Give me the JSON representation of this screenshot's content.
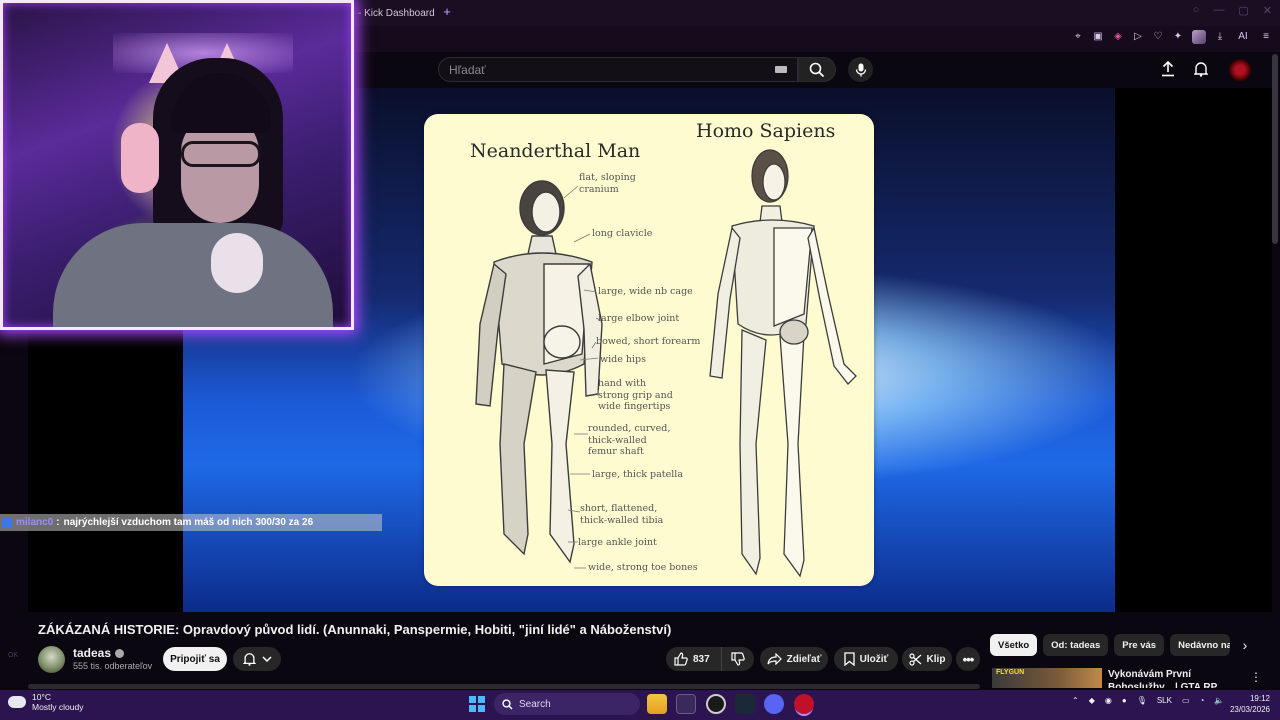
{
  "browser": {
    "tab_title": "- Kick Dashboard",
    "new_tab": "+",
    "ext_ai_label": "AI"
  },
  "youtube": {
    "search_placeholder": "Hľadať"
  },
  "image_card": {
    "title_left": "Neanderthal Man",
    "title_right": "Homo Sapiens",
    "labels": [
      "flat, sloping\ncranium",
      "long clavicle",
      "large, wide nb cage",
      "large elbow joint",
      "bowed, short forearm",
      "wide hips",
      "hand with\nstrong grip and\nwide fingertips",
      "rounded, curved,\nthick-walled\nfemur shaft",
      "large, thick patella",
      "short, flattened,\nthick-walled tibia",
      "large ankle joint",
      "wide, strong toe bones"
    ]
  },
  "chat": {
    "user": "milanc0",
    "separator": ":",
    "message": "najrýchlejší vzduchom tam máš od nich 300/30 za 26"
  },
  "video": {
    "title": "ZÁKÁZANÁ HISTORIE: Opravdový původ lidí. (Anunnaki, Panspermie, Hobiti, \"jiní lidé\" a Náboženství)",
    "channel": "tadeas",
    "subscribers": "555 tis. odberateľov",
    "join_label": "Pripojiť sa",
    "likes": "837",
    "share_label": "Zdieľať",
    "save_label": "Uložiť",
    "clip_label": "Klip"
  },
  "chips": [
    "Všetko",
    "Od: tadeas",
    "Pre vás",
    "Nedávno nahr"
  ],
  "recommendation": {
    "thumb_text": "FLYGUN",
    "title": "Vykonávám První Bohoslužby... | GTA RP"
  },
  "side_tag": "OK",
  "taskbar": {
    "temperature": "10°C",
    "weather": "Mostly cloudy",
    "search_label": "Search",
    "language": "SLK",
    "time": "19:12",
    "date": "23/03/2026"
  },
  "colors": {
    "accent_purple": "#b04bff",
    "taskbar": "#2c1450",
    "card_bg": "#fdfbcf"
  }
}
